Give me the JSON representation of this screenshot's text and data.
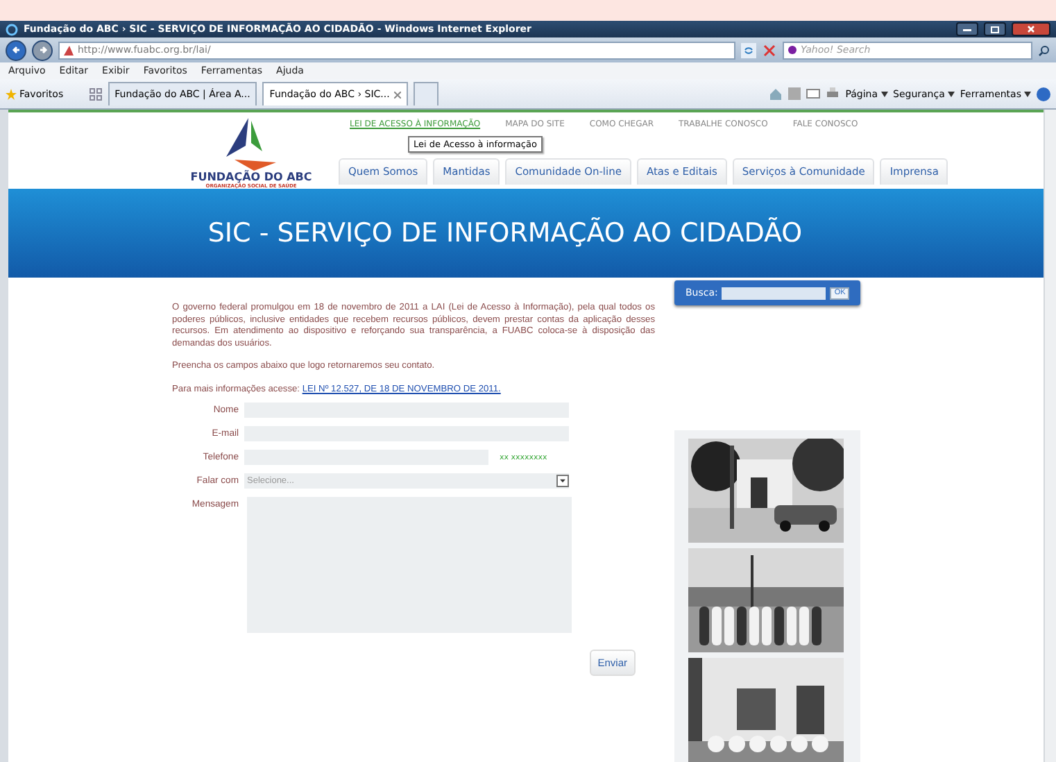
{
  "window": {
    "title": "Fundação do ABC › SIC - SERVIÇO DE INFORMAÇÃO AO CIDADÃO - Windows Internet Explorer"
  },
  "address": {
    "url": "http://www.fuabc.org.br/lai/"
  },
  "search": {
    "placeholder": "Yahoo! Search"
  },
  "menu": [
    "Arquivo",
    "Editar",
    "Exibir",
    "Favoritos",
    "Ferramentas",
    "Ajuda"
  ],
  "favorites": {
    "label": "Favoritos"
  },
  "tabs": [
    {
      "label": "Fundação do ABC | Área A...",
      "selected": false
    },
    {
      "label": "Fundação do ABC › SIC...",
      "selected": true
    }
  ],
  "commands": [
    "Página",
    "Segurança",
    "Ferramentas"
  ],
  "site": {
    "logo": {
      "name": "FUNDAÇÃO DO ABC",
      "subtitle": "ORGANIZAÇÃO SOCIAL DE SAÚDE"
    },
    "top_links": [
      {
        "label": "LEI DE ACESSO À INFORMAÇÃO",
        "selected": true
      },
      {
        "label": "MAPA DO SITE",
        "selected": false
      },
      {
        "label": "COMO CHEGAR",
        "selected": false
      },
      {
        "label": "TRABALHE CONOSCO",
        "selected": false
      },
      {
        "label": "FALE CONOSCO",
        "selected": false
      }
    ],
    "tooltip": "Lei de Acesso à informação",
    "nav": [
      "Quem Somos",
      "Mantidas",
      "Comunidade On-line",
      "Atas e Editais",
      "Serviços à Comunidade",
      "Imprensa"
    ],
    "banner": "SIC - SERVIÇO DE INFORMAÇÃO AO CIDADÃO",
    "busca": {
      "label": "Busca:",
      "button": "OK"
    },
    "intro": "O governo federal promulgou em 18 de novembro de 2011 a LAI (Lei de Acesso à Informação), pela qual todos os poderes públicos, inclusive entidades que recebem recursos públicos, devem prestar contas da aplicação desses recursos. Em atendimento ao dispositivo e reforçando sua transparência, a FUABC coloca-se à disposição das demandas dos usuários.",
    "instructions": "Preencha os campos abaixo que logo retornaremos seu contato.",
    "more_info": {
      "text": "Para mais informações acesse:",
      "link": "LEI Nº 12.527, DE 18 DE NOVEMBRO DE 2011."
    },
    "form": [
      {
        "kind": "text",
        "label": "Nome"
      },
      {
        "kind": "text",
        "label": "E-mail"
      },
      {
        "kind": "phone",
        "label": "Telefone",
        "hint": "xx xxxxxxxx"
      },
      {
        "kind": "select",
        "label": "Falar com",
        "placeholder": "Selecione..."
      },
      {
        "kind": "textarea",
        "label": "Mensagem"
      }
    ],
    "submit": "Enviar"
  }
}
